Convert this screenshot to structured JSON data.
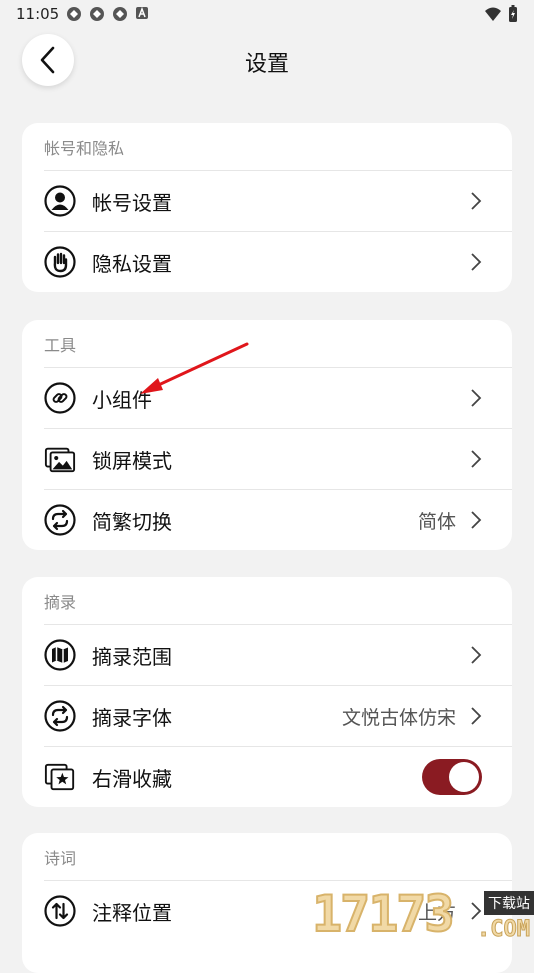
{
  "status_bar": {
    "time": "11:05",
    "icons": [
      "app-icon",
      "app-icon",
      "app-icon",
      "a-icon"
    ],
    "right_icons": [
      "wifi-icon",
      "battery-icon"
    ]
  },
  "header": {
    "title": "设置",
    "back_icon": "chevron-left-icon"
  },
  "sections": [
    {
      "title": "帐号和隐私",
      "rows": [
        {
          "label": "帐号设置",
          "icon": "person-icon",
          "value": "",
          "control": "chevron"
        },
        {
          "label": "隐私设置",
          "icon": "hand-icon",
          "value": "",
          "control": "chevron"
        }
      ]
    },
    {
      "title": "工具",
      "rows": [
        {
          "label": "小组件",
          "icon": "link-icon",
          "value": "",
          "control": "chevron"
        },
        {
          "label": "锁屏模式",
          "icon": "image-icon",
          "value": "",
          "control": "chevron"
        },
        {
          "label": "简繁切换",
          "icon": "refresh-icon",
          "value": "简体",
          "control": "chevron"
        }
      ]
    },
    {
      "title": "摘录",
      "rows": [
        {
          "label": "摘录范围",
          "icon": "map-icon",
          "value": "",
          "control": "chevron"
        },
        {
          "label": "摘录字体",
          "icon": "refresh-icon",
          "value": "文悦古体仿宋",
          "control": "chevron"
        },
        {
          "label": "右滑收藏",
          "icon": "star-icon",
          "value": "",
          "control": "toggle",
          "toggle_on": true
        }
      ]
    },
    {
      "title": "诗词",
      "rows": [
        {
          "label": "注释位置",
          "icon": "sort-icon",
          "value": "上方",
          "control": "chevron"
        }
      ]
    }
  ],
  "colors": {
    "accent": "#8a1b22",
    "background": "#f2f2f2",
    "card": "#ffffff",
    "annotation": "#e0161b"
  },
  "watermark": {
    "number": "17173",
    "tag": "下载站",
    "suffix": ".COM"
  }
}
